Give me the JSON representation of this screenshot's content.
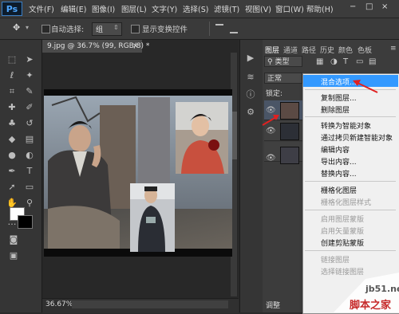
{
  "app": {
    "logo": "Ps"
  },
  "menubar": {
    "items": [
      "文件(F)",
      "编辑(E)",
      "图像(I)",
      "图层(L)",
      "文字(Y)",
      "选择(S)",
      "滤镜(T)",
      "视图(V)",
      "窗口(W)",
      "帮助(H)"
    ]
  },
  "options": {
    "auto_select_label": "自动选择:",
    "auto_select_value": "组",
    "show_transform_label": "显示变换控件"
  },
  "document": {
    "tab_title": "9.jpg @ 36.7% (99, RGB/8) *",
    "tab_close": "×",
    "zoom": "36.67%"
  },
  "layers_panel": {
    "tabs": [
      "图层",
      "通道",
      "路径",
      "历史",
      "颜色",
      "色板"
    ],
    "kind_filter": "类型",
    "blend_mode": "正常",
    "lock_label": "锁定:",
    "bottom_label": "调整"
  },
  "context_menu": {
    "items": [
      {
        "label": "混合选项...",
        "enabled": true,
        "highlighted": true
      },
      {
        "label": "复制图层...",
        "enabled": true
      },
      {
        "label": "删除图层",
        "enabled": true
      },
      {
        "label": "转换为智能对象",
        "enabled": true
      },
      {
        "label": "通过拷贝新建智能对象",
        "enabled": true
      },
      {
        "label": "编辑内容",
        "enabled": true
      },
      {
        "label": "导出内容...",
        "enabled": true
      },
      {
        "label": "替换内容...",
        "enabled": true
      },
      {
        "label": "栅格化图层",
        "enabled": true
      },
      {
        "label": "栅格化图层样式",
        "enabled": false
      },
      {
        "label": "启用图层蒙版",
        "enabled": false
      },
      {
        "label": "启用矢量蒙版",
        "enabled": false
      },
      {
        "label": "创建剪贴蒙版",
        "enabled": true
      },
      {
        "label": "链接图层",
        "enabled": false
      },
      {
        "label": "选择链接图层",
        "enabled": false
      }
    ]
  },
  "watermark": {
    "line1": "jb51.net",
    "line2": "脚本之家"
  },
  "colors": {
    "highlight": "#3399ff",
    "arrow": "#e02020"
  }
}
